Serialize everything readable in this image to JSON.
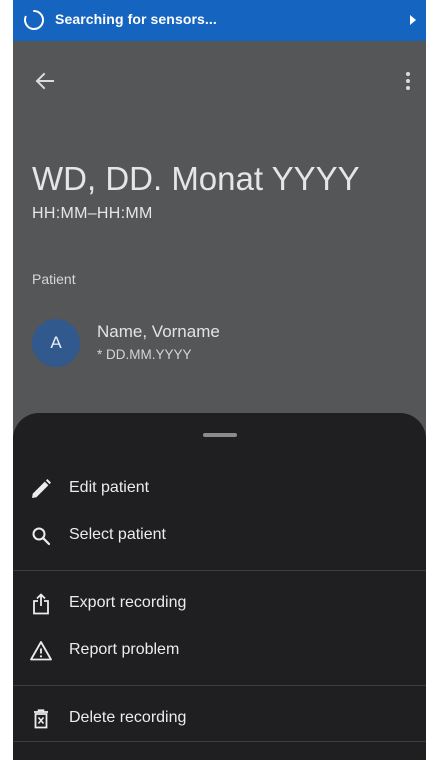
{
  "status_bar": {
    "text": "Searching for sensors...",
    "color": "#1565c0",
    "spinner_icon": "spinner-icon",
    "expand_icon": "caret-right-icon"
  },
  "app_bar": {
    "back_icon": "arrow-back-icon",
    "more_icon": "more-vertical-icon"
  },
  "header": {
    "title": "WD, DD. Monat YYYY",
    "time_range": "HH:MM–HH:MM"
  },
  "patient_section": {
    "label": "Patient",
    "avatar_letter": "A",
    "avatar_color": "#31598e",
    "name": "Name, Vorname",
    "birth_date": "* DD.MM.YYYY"
  },
  "bottom_sheet": {
    "items": [
      {
        "label": "Edit patient",
        "icon": "pencil-icon"
      },
      {
        "label": "Select patient",
        "icon": "search-icon"
      },
      {
        "label": "Export recording",
        "icon": "share-export-icon"
      },
      {
        "label": "Report problem",
        "icon": "warning-icon"
      },
      {
        "label": "Delete recording",
        "icon": "delete-icon"
      }
    ]
  }
}
